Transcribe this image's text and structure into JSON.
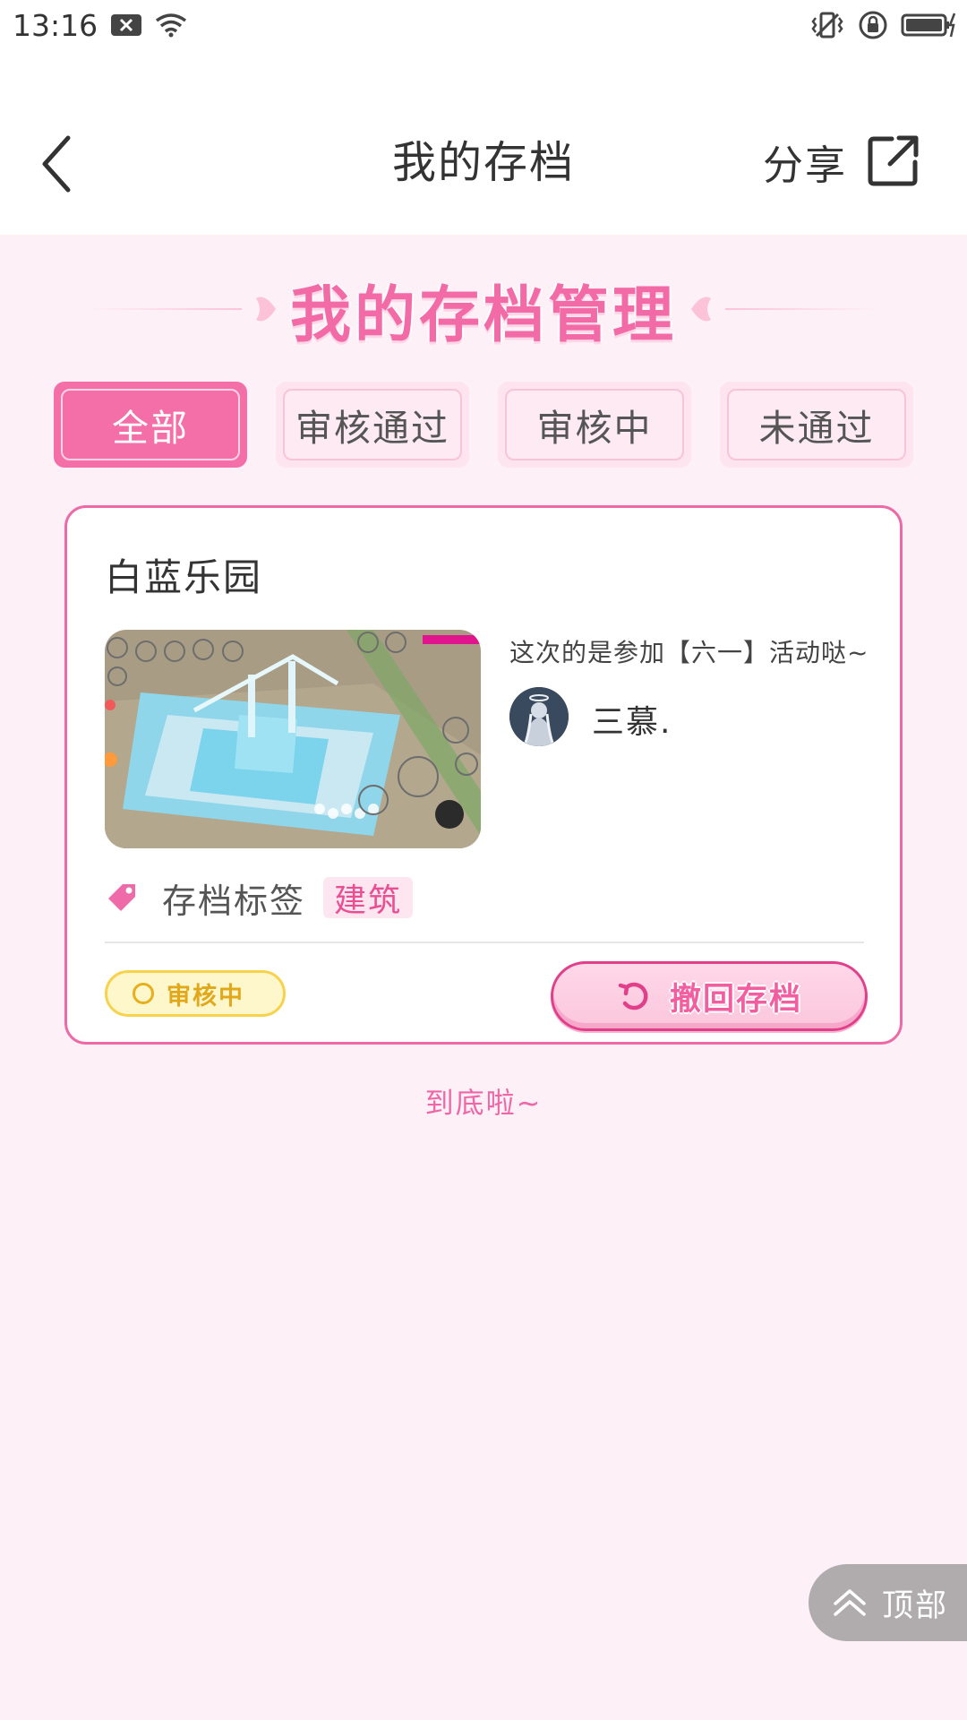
{
  "status_bar": {
    "time": "13:16",
    "icons": [
      "notification-x-icon",
      "wifi-icon",
      "vibrate-icon",
      "rotation-lock-icon",
      "battery-charging-icon"
    ]
  },
  "header": {
    "title": "我的存档",
    "share_label": "分享"
  },
  "section": {
    "heading": "我的存档管理"
  },
  "tabs": [
    {
      "label": "全部",
      "active": true
    },
    {
      "label": "审核通过",
      "active": false
    },
    {
      "label": "审核中",
      "active": false
    },
    {
      "label": "未通过",
      "active": false
    }
  ],
  "card": {
    "title": "白蓝乐园",
    "description": "这次的是参加【六一】活动哒~",
    "author": "三慕.",
    "tag_label": "存档标签",
    "tag_value": "建筑",
    "status": "审核中",
    "revoke_label": "撤回存档"
  },
  "footer": {
    "end_text": "到底啦~",
    "top_label": "顶部"
  },
  "colors": {
    "accent_pink": "#f46ea8",
    "background": "#fdf0f7",
    "status_yellow": "#f7d24b"
  }
}
